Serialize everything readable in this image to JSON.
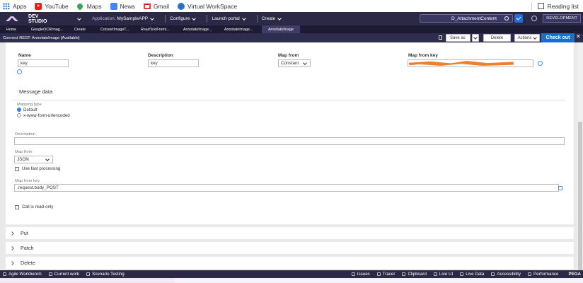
{
  "bookmarks": {
    "items": [
      {
        "label": "Apps",
        "icon": "apps-grid-icon"
      },
      {
        "label": "YouTube",
        "icon": "youtube-icon"
      },
      {
        "label": "Maps",
        "icon": "maps-pin-icon"
      },
      {
        "label": "News",
        "icon": "news-icon"
      },
      {
        "label": "Gmail",
        "icon": "gmail-icon"
      },
      {
        "label": "Virtual WorkSpace",
        "icon": "workspace-icon"
      }
    ],
    "reading_list": "Reading list"
  },
  "appbar": {
    "brand": "DEV STUDIO",
    "application_prefix": "Application:",
    "application_name": "MySampleAPP",
    "configure": "Configure",
    "launch_portal": "Launch portal",
    "create": "Create",
    "search_value": "D_AttachmentContent",
    "env_badge": "DEVELOPMENT",
    "colors": {
      "bar": "#2b2945",
      "accent": "#1a6ed8"
    }
  },
  "tabs": [
    "Home",
    "GoogleOCRImag...",
    "Create",
    "ConvertImageT...",
    "ReadTextFromI...",
    "AnnotateImage...",
    "AnnotateImage...",
    "AnnotateImage"
  ],
  "subheader": {
    "title": "Connect REST: AnnotateImage [Available]",
    "save_as": "Save as",
    "delete": "Delete",
    "actions": "Actions",
    "checkout": "Check out"
  },
  "params_table": {
    "headers": {
      "name": "Name",
      "description": "Description",
      "map_from": "Map from",
      "map_from_key": "Map from key"
    },
    "row": {
      "name": "key",
      "description": "key",
      "map_from": "Constant"
    }
  },
  "message_data": {
    "title": "Message data",
    "mapping_type_label": "Mapping type",
    "options": [
      "Default",
      "x-www-form-urlencoded"
    ],
    "description_label": "Description",
    "description_value": "",
    "map_from_label": "Map from",
    "map_from_value": "JSON",
    "fast_processing": "Use fast processing",
    "map_from_key_label": "Map from key",
    "map_from_key_value": ".request.body_POST",
    "read_only": "Call is read-only"
  },
  "accordions": [
    "Put",
    "Patch",
    "Delete"
  ],
  "bottom_toolbar": {
    "left": [
      "Agile Workbench",
      "Current work",
      "Scenario Testing"
    ],
    "right": [
      "Issues",
      "Tracer",
      "Clipboard",
      "Live UI",
      "Live Data",
      "Accessibility",
      "Performance"
    ],
    "brand": "PEGA"
  }
}
